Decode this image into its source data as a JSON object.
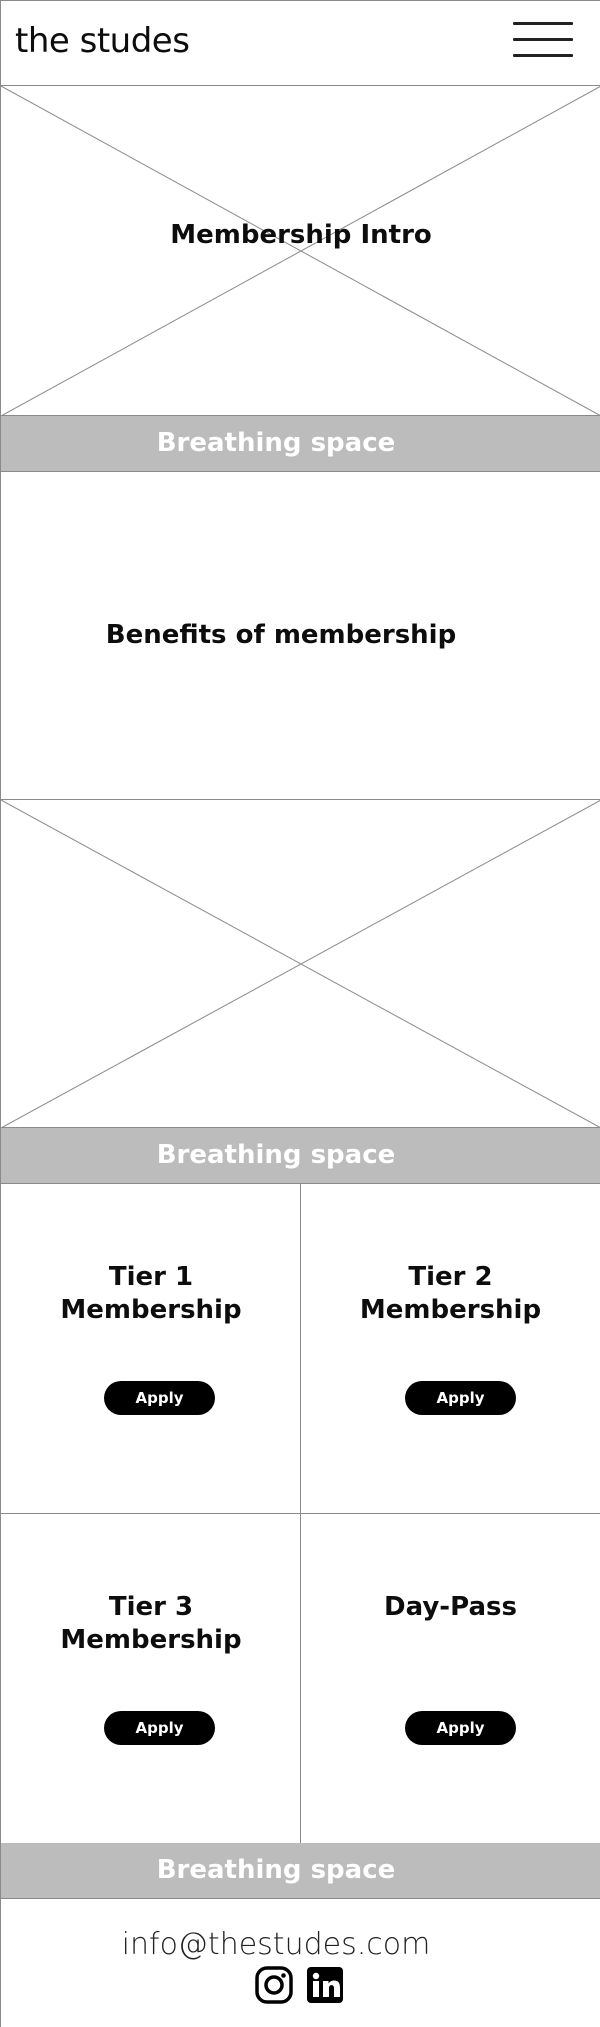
{
  "header": {
    "brand": "the studes"
  },
  "intro": {
    "title": "Membership Intro"
  },
  "breathing_label": "Breathing space",
  "benefits": {
    "title": "Benefits of membership"
  },
  "tiers": [
    {
      "title_line1": "Tier 1",
      "title_line2": "Membership",
      "button": "Apply"
    },
    {
      "title_line1": "Tier 2",
      "title_line2": "Membership",
      "button": "Apply"
    },
    {
      "title_line1": "Tier 3",
      "title_line2": "Membership",
      "button": "Apply"
    },
    {
      "title_line1": "Day-Pass",
      "title_line2": "",
      "button": "Apply"
    }
  ],
  "footer": {
    "email": "info@thestudes.com",
    "icons": [
      "instagram-icon",
      "linkedin-icon"
    ]
  },
  "colors": {
    "breathing_bg": "#bcbcbc",
    "button_bg": "#000000",
    "border": "#8a8a8a"
  }
}
